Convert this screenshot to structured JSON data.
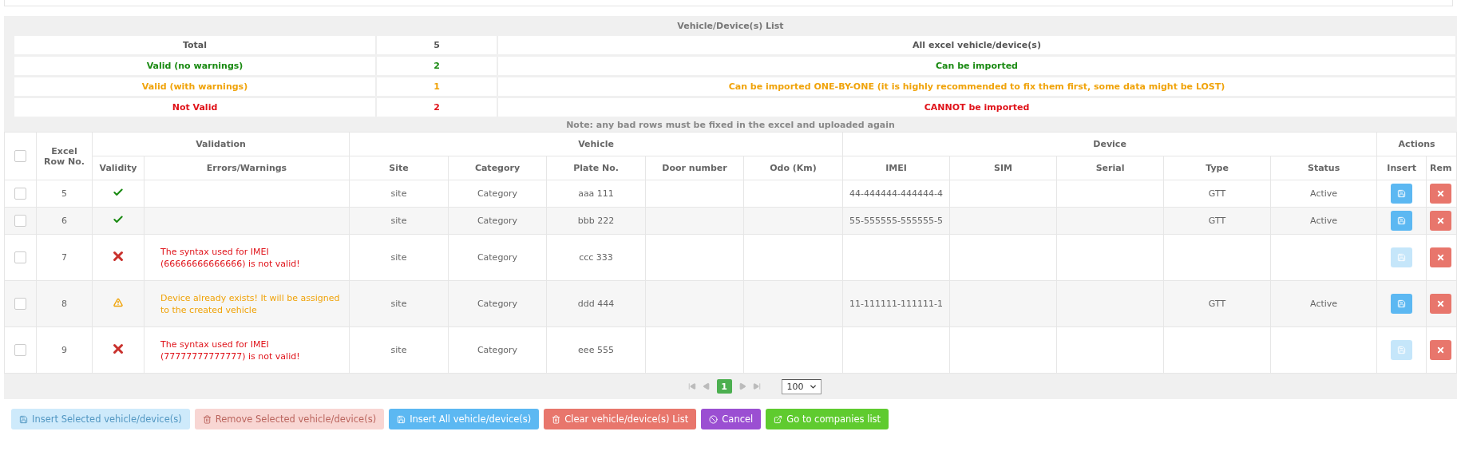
{
  "summary": {
    "title": "Vehicle/Device(s) List",
    "rows": [
      {
        "label": "Total",
        "count": "5",
        "description": "All excel vehicle/device(s)",
        "kind": "neutral"
      },
      {
        "label": "Valid (no warnings)",
        "count": "2",
        "description": "Can be imported",
        "kind": "ok"
      },
      {
        "label": "Valid (with warnings)",
        "count": "1",
        "description": "Can be imported ONE-BY-ONE (it is highly recommended to fix them first, some data might be LOST)",
        "kind": "warn"
      },
      {
        "label": "Not Valid",
        "count": "2",
        "description": "CANNOT be imported",
        "kind": "error"
      }
    ],
    "note": "Note: any bad rows must be fixed in the excel and uploaded again"
  },
  "table": {
    "select_all_checked": false,
    "excel_row_header": "Excel Row No.",
    "groups": [
      {
        "label": "Validation",
        "columns": [
          "Validity",
          "Errors/Warnings"
        ]
      },
      {
        "label": "Vehicle",
        "columns": [
          "Site",
          "Category",
          "Plate No.",
          "Door number",
          "Odo (Km)"
        ]
      },
      {
        "label": "Device",
        "columns": [
          "IMEI",
          "SIM",
          "Serial",
          "Type",
          "Status"
        ]
      },
      {
        "label": "Actions",
        "columns": [
          "Insert",
          "Rem"
        ]
      }
    ],
    "rows": [
      {
        "checked": false,
        "row_no": "5",
        "kind": "valid",
        "site": "site",
        "category": "Category",
        "plate_no": "aaa 111",
        "imei": "44-444444-444444-4",
        "type": "GTT",
        "status": "Active",
        "insert_disabled": false
      },
      {
        "checked": false,
        "row_no": "6",
        "kind": "valid",
        "site": "site",
        "category": "Category",
        "plate_no": "bbb 222",
        "imei": "55-555555-555555-5",
        "type": "GTT",
        "status": "Active",
        "insert_disabled": false
      },
      {
        "checked": false,
        "row_no": "7",
        "kind": "invalid",
        "message": "The syntax used for IMEI (66666666666666) is not valid!",
        "site": "site",
        "category": "Category",
        "plate_no": "ccc 333",
        "insert_disabled": true
      },
      {
        "checked": false,
        "row_no": "8",
        "kind": "warning",
        "message": "Device already exists! It will be assigned to the created vehicle",
        "site": "site",
        "category": "Category",
        "plate_no": "ddd 444",
        "imei": "11-111111-111111-1",
        "type": "GTT",
        "status": "Active",
        "insert_disabled": false
      },
      {
        "checked": false,
        "row_no": "9",
        "kind": "invalid",
        "message": "The syntax used for IMEI (77777777777777) is not valid!",
        "site": "site",
        "category": "Category",
        "plate_no": "eee 555",
        "insert_disabled": true
      }
    ]
  },
  "pagination": {
    "pages": [
      {
        "label": "1",
        "selected": true
      }
    ],
    "page_size": "100"
  },
  "buttons": [
    {
      "label": "Insert Selected vehicle/device(s)",
      "kind": "insert",
      "disabled": true
    },
    {
      "label": "Remove Selected vehicle/device(s)",
      "kind": "remove",
      "disabled": true
    },
    {
      "label": "Insert All vehicle/device(s)",
      "kind": "insert",
      "disabled": false
    },
    {
      "label": "Clear vehicle/device(s) List",
      "kind": "clear",
      "disabled": false
    },
    {
      "label": "Cancel",
      "kind": "cancel",
      "disabled": false
    },
    {
      "label": "Go to companies list",
      "kind": "goto",
      "disabled": false
    }
  ]
}
